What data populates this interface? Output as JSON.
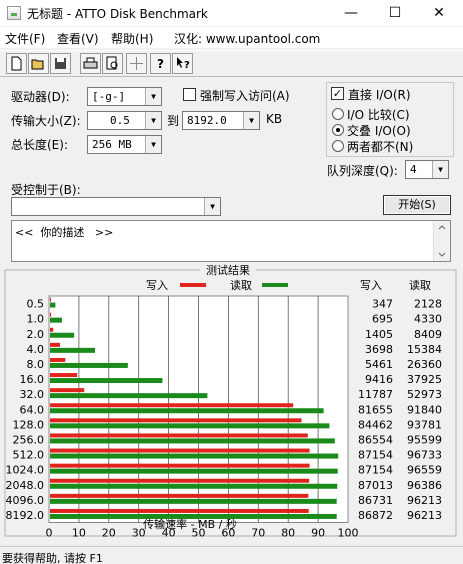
{
  "window": {
    "title": "无标题 - ATTO Disk Benchmark",
    "minimize": "—",
    "maximize": "☐",
    "close": "✕"
  },
  "menu": {
    "file": "文件(F)",
    "view": "查看(V)",
    "help": "帮助(H)",
    "localized": "汉化: www.upantool.com"
  },
  "toolbar": {
    "new": "new-icon",
    "open": "open-icon",
    "save": "save-icon",
    "print": "print-icon",
    "preview": "print-preview-icon",
    "move": "move-icon",
    "help": "help-icon",
    "context_help": "context-help-icon"
  },
  "settings": {
    "drive_label": "驱动器(D):",
    "drive_value": "[-g-]",
    "force_write_label": "强制写入访问(A)",
    "transfer_label": "传输大小(Z):",
    "transfer_from": "0.5",
    "to_label": "到",
    "transfer_to": "8192.0",
    "kb_unit": "KB",
    "total_label": "总长度(E):",
    "total_value": "256 MB",
    "direct_io_label": "直接 I/O(R)",
    "io_compare_label": "I/O 比较(C)",
    "overlap_label": "交叠 I/O(O)",
    "neither_label": "两者都不(N)",
    "queue_label": "队列深度(Q):",
    "queue_value": "4",
    "controlled_label": "受控制于(B):",
    "controlled_value": "",
    "start_button": "开始(S)",
    "description": "<<  你的描述   >>"
  },
  "chart_data": {
    "type": "bar",
    "title": "测试结果",
    "legend_write": "写入",
    "legend_read": "读取",
    "col_write": "写入",
    "col_read": "读取",
    "xlabel": "传输速率 - MB / 秒",
    "xlim": [
      0,
      100
    ],
    "xticks": [
      "0",
      "10",
      "20",
      "30",
      "40",
      "50",
      "60",
      "70",
      "80",
      "90",
      "100"
    ],
    "categories": [
      "0.5",
      "1.0",
      "2.0",
      "4.0",
      "8.0",
      "16.0",
      "32.0",
      "64.0",
      "128.0",
      "256.0",
      "512.0",
      "1024.0",
      "2048.0",
      "4096.0",
      "8192.0"
    ],
    "series": [
      {
        "name": "写入",
        "color": "#e0241c",
        "values": [
          0.347,
          0.695,
          1.405,
          3.698,
          5.461,
          9.416,
          11.787,
          81.655,
          84.462,
          86.554,
          87.154,
          87.154,
          87.013,
          86.731,
          86.872
        ]
      },
      {
        "name": "读取",
        "color": "#1a8a1a",
        "values": [
          2.128,
          4.33,
          8.409,
          15.384,
          26.36,
          37.925,
          52.973,
          91.84,
          93.781,
          95.599,
          96.733,
          96.559,
          96.386,
          96.213,
          96.213
        ]
      }
    ],
    "write_text": [
      "347",
      "695",
      "1405",
      "3698",
      "5461",
      "9416",
      "11787",
      "81655",
      "84462",
      "86554",
      "87154",
      "87154",
      "87013",
      "86731",
      "86872"
    ],
    "read_text": [
      "2128",
      "4330",
      "8409",
      "15384",
      "26360",
      "37925",
      "52973",
      "91840",
      "93781",
      "95599",
      "96733",
      "96559",
      "96386",
      "96213",
      "96213"
    ]
  },
  "status": {
    "text": "要获得帮助, 请按 F1"
  }
}
